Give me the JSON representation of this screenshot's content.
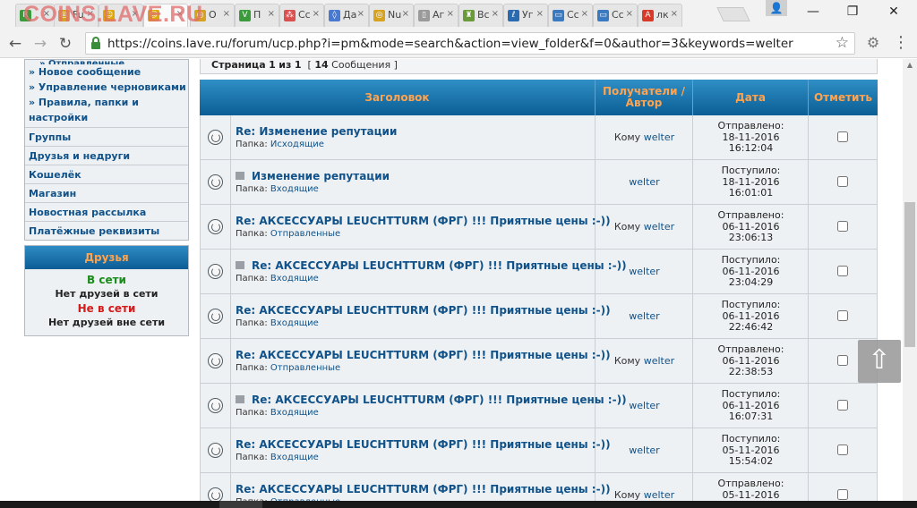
{
  "browser": {
    "watermark": "COINS.LAVE.RU",
    "tabs": [
      {
        "label": "",
        "color": "#3b9a3b",
        "glyph": "R",
        "active": false
      },
      {
        "label": "Fu",
        "color": "#d7a21f",
        "glyph": "◎",
        "active": false
      },
      {
        "label": "",
        "color": "#e0a800",
        "glyph": "☺",
        "active": false
      },
      {
        "label": "",
        "color": "#e0a800",
        "glyph": "☺",
        "active": true
      },
      {
        "label": "О",
        "color": "#d7a21f",
        "glyph": "◎",
        "active": false
      },
      {
        "label": "П",
        "color": "#3b9a3b",
        "glyph": "V",
        "active": false
      },
      {
        "label": "Сс",
        "color": "#d85050",
        "glyph": "⁂",
        "active": false
      },
      {
        "label": "Да",
        "color": "#4a7ad0",
        "glyph": "◊",
        "active": false
      },
      {
        "label": "Nu",
        "color": "#d7a21f",
        "glyph": "◎",
        "active": false
      },
      {
        "label": "Аг",
        "color": "#9a9a9a",
        "glyph": "▯",
        "active": false
      },
      {
        "label": "Вс",
        "color": "#6a9a3a",
        "glyph": "♜",
        "active": false
      },
      {
        "label": "Уг",
        "color": "#2a6ab0",
        "glyph": "ℓ",
        "active": false
      },
      {
        "label": "Сс",
        "color": "#3a7ac0",
        "glyph": "▭",
        "active": false
      },
      {
        "label": "Сс",
        "color": "#3a7ac0",
        "glyph": "▭",
        "active": false
      },
      {
        "label": "лк",
        "color": "#d83a2a",
        "glyph": "A",
        "active": false
      }
    ],
    "tab_close_glyph": "×",
    "profile_glyph": "👤",
    "window_buttons": {
      "minimize": "—",
      "restore": "❐",
      "close": "✕"
    },
    "nav": {
      "back": "←",
      "forward": "→",
      "reload": "↻"
    },
    "url": "https://coins.lave.ru/forum/ucp.php?i=pm&mode=search&action=view_folder&f=0&author=3&keywords=welter",
    "bookmark_glyph": "☆",
    "extension_glyph": "⚙",
    "menu_glyph": "⋮"
  },
  "sidebar": {
    "cut_item": "» Отправленные",
    "links": [
      "» Новое сообщение",
      "» Управление черновиками",
      "» Правила, папки и настройки"
    ],
    "sections": [
      "Группы",
      "Друзья и недруги",
      "Кошелёк",
      "Магазин",
      "Новостная рассылка",
      "Платёжные реквизиты"
    ],
    "friends": {
      "title": "Друзья",
      "online_label": "В сети",
      "online_none": "Нет друзей в сети",
      "offline_label": "Не в сети",
      "offline_none": "Нет друзей вне сети"
    }
  },
  "pagination": {
    "page_text": "Страница",
    "page_current": "1",
    "of_text": "из",
    "page_total": "1",
    "count": "14",
    "count_label": "Сообщения"
  },
  "table": {
    "headers": {
      "subject": "Заголовок",
      "recipients": "Получатели / Автор",
      "date": "Дата",
      "mark": "Отметить"
    },
    "folder_label": "Папка:",
    "to_label": "Кому",
    "rows": [
      {
        "subject": "Re: Изменение репутации",
        "attach": false,
        "folder": "Исходящие",
        "to": true,
        "author": "welter",
        "status": "Отправлено:",
        "date": "18-11-2016",
        "time": "16:12:04"
      },
      {
        "subject": "Изменение репутации",
        "attach": true,
        "folder": "Входящие",
        "to": false,
        "author": "welter",
        "status": "Поступило:",
        "date": "18-11-2016",
        "time": "16:01:01"
      },
      {
        "subject": "Re: АКСЕССУАРЫ LEUCHTTURM (ФРГ) !!! Приятные цены :-))",
        "attach": false,
        "folder": "Отправленные",
        "to": true,
        "author": "welter",
        "status": "Отправлено:",
        "date": "06-11-2016",
        "time": "23:06:13"
      },
      {
        "subject": "Re: АКСЕССУАРЫ LEUCHTTURM (ФРГ) !!! Приятные цены :-))",
        "attach": true,
        "folder": "Входящие",
        "to": false,
        "author": "welter",
        "status": "Поступило:",
        "date": "06-11-2016",
        "time": "23:04:29"
      },
      {
        "subject": "Re: АКСЕССУАРЫ LEUCHTTURM (ФРГ) !!! Приятные цены :-))",
        "attach": false,
        "folder": "Входящие",
        "to": false,
        "author": "welter",
        "status": "Поступило:",
        "date": "06-11-2016",
        "time": "22:46:42"
      },
      {
        "subject": "Re: АКСЕССУАРЫ LEUCHTTURM (ФРГ) !!! Приятные цены :-))",
        "attach": false,
        "folder": "Отправленные",
        "to": true,
        "author": "welter",
        "status": "Отправлено:",
        "date": "06-11-2016",
        "time": "22:38:53"
      },
      {
        "subject": "Re: АКСЕССУАРЫ LEUCHTTURM (ФРГ) !!! Приятные цены :-))",
        "attach": true,
        "folder": "Входящие",
        "to": false,
        "author": "welter",
        "status": "Поступило:",
        "date": "06-11-2016",
        "time": "16:07:31"
      },
      {
        "subject": "Re: АКСЕССУАРЫ LEUCHTTURM (ФРГ) !!! Приятные цены :-))",
        "attach": false,
        "folder": "Входящие",
        "to": false,
        "author": "welter",
        "status": "Поступило:",
        "date": "05-11-2016",
        "time": "15:54:02"
      },
      {
        "subject": "Re: АКСЕССУАРЫ LEUCHTTURM (ФРГ) !!! Приятные цены :-))",
        "attach": false,
        "folder": "Отправленные",
        "to": true,
        "author": "welter",
        "status": "Отправлено:",
        "date": "05-11-2016",
        "time": ""
      }
    ]
  },
  "back_to_top_glyph": "⇧",
  "colors": {
    "accent_blue": "#105289",
    "header_orange": "#ffa34f",
    "online_green": "#1a8b1a",
    "offline_red": "#d31b1b"
  }
}
